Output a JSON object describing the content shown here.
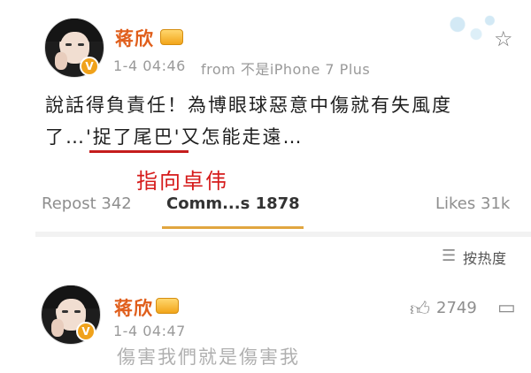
{
  "post": {
    "author": "蒋欣",
    "timestamp": "1-4 04:46",
    "source": "from 不是iPhone 7 Plus",
    "text_line1": "說話得負責任！為博眼球惡意中傷就有失風度",
    "text_line2_pre": "了…",
    "text_line2_highlight": "'捉了尾巴'",
    "text_line2_post": "又怎能走遠…",
    "repost": "Repost 342",
    "comments": "Comm...s 1878",
    "likes": "Likes 31k"
  },
  "annotation": {
    "text": "指向卓伟",
    "color": "#d61b1b"
  },
  "comments_section": {
    "sort_label": "按热度"
  },
  "comment": {
    "author": "蒋欣",
    "timestamp": "1-4 04:47",
    "likes": "2749",
    "partial_text": "傷害我們就是傷害我"
  },
  "icons": {
    "star": "star-icon",
    "sort": "sort-icon",
    "thumb": "thumbs-up-icon",
    "comment": "comment-icon",
    "verified": "verified-icon",
    "crown": "crown-badge-icon"
  },
  "colors": {
    "name": "#e05e1b",
    "verified": "#f0a21b"
  }
}
